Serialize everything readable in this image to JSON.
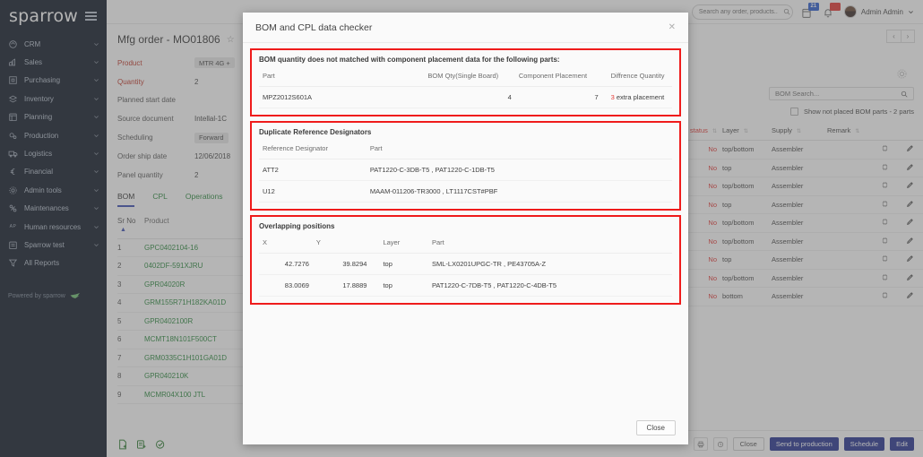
{
  "sidebar": {
    "brand": "sparrow",
    "footer": "Powered by sparrow",
    "items": [
      {
        "label": "CRM",
        "icon": "crm-icon",
        "expandable": true
      },
      {
        "label": "Sales",
        "icon": "sales-icon",
        "expandable": true
      },
      {
        "label": "Purchasing",
        "icon": "purchasing-icon",
        "expandable": true
      },
      {
        "label": "Inventory",
        "icon": "inventory-icon",
        "expandable": true
      },
      {
        "label": "Planning",
        "icon": "planning-icon",
        "expandable": true
      },
      {
        "label": "Production",
        "icon": "production-icon",
        "expandable": true
      },
      {
        "label": "Logistics",
        "icon": "logistics-icon",
        "expandable": true
      },
      {
        "label": "Financial",
        "icon": "financial-icon",
        "expandable": true
      },
      {
        "label": "Admin tools",
        "icon": "admin-tools-icon",
        "expandable": true
      },
      {
        "label": "Maintenances",
        "icon": "maintenances-icon",
        "expandable": true
      },
      {
        "label": "Human resources",
        "icon": "human-resources-icon",
        "expandable": true
      },
      {
        "label": "Sparrow test",
        "icon": "sparrow-test-icon",
        "expandable": true
      },
      {
        "label": "All Reports",
        "icon": "all-reports-icon",
        "expandable": false
      }
    ]
  },
  "topbar": {
    "search_placeholder": "Search any order, products..",
    "calendar_badge": "21",
    "notification_badge": "55",
    "user_name": "Admin Admin"
  },
  "order": {
    "title": "Mfg order - MO01806",
    "fields": [
      {
        "label": "Product",
        "value": "MTR 4G +",
        "required": true,
        "pill": true
      },
      {
        "label": "Quantity",
        "value": "2",
        "required": true,
        "pill": false
      },
      {
        "label": "Planned start date",
        "value": "",
        "required": false,
        "pill": false
      },
      {
        "label": "Source document",
        "value": "Intellal-1C",
        "required": false,
        "pill": false
      },
      {
        "label": "Scheduling",
        "value": "Forward",
        "required": false,
        "pill": true
      },
      {
        "label": "Order ship date",
        "value": "12/06/2018",
        "required": false,
        "pill": false
      },
      {
        "label": "Panel quantity",
        "value": "2",
        "required": false,
        "pill": false
      }
    ],
    "tabs": [
      {
        "label": "BOM",
        "active": true
      },
      {
        "label": "CPL",
        "active": false
      },
      {
        "label": "Operations",
        "active": false
      }
    ]
  },
  "bom_table": {
    "columns": {
      "sr_no": "Sr No",
      "product": "Product"
    },
    "rows": [
      {
        "sr": "1",
        "product": "GPC0402104-16"
      },
      {
        "sr": "2",
        "product": "0402DF-591XJRU"
      },
      {
        "sr": "3",
        "product": "GPR04020R"
      },
      {
        "sr": "4",
        "product": "GRM155R71H182KA01D"
      },
      {
        "sr": "5",
        "product": "GPR0402100R"
      },
      {
        "sr": "6",
        "product": "MCMT18N101F500CT"
      },
      {
        "sr": "7",
        "product": "GRM0335C1H101GA01D"
      },
      {
        "sr": "8",
        "product": "GPR040210K"
      },
      {
        "sr": "9",
        "product": "MCMR04X100 JTL"
      }
    ]
  },
  "right_panel": {
    "bom_search_placeholder": "BOM Search...",
    "not_placed_label": "Show not placed BOM parts - 2 parts",
    "columns": {
      "stock_status": "k status",
      "layer": "Layer",
      "supply": "Supply",
      "remark": "Remark"
    },
    "rows": [
      {
        "status": "No",
        "layer": "top/bottom",
        "supply": "Assembler",
        "remark": ""
      },
      {
        "status": "No",
        "layer": "top",
        "supply": "Assembler",
        "remark": ""
      },
      {
        "status": "No",
        "layer": "top/bottom",
        "supply": "Assembler",
        "remark": ""
      },
      {
        "status": "No",
        "layer": "top",
        "supply": "Assembler",
        "remark": ""
      },
      {
        "status": "No",
        "layer": "top/bottom",
        "supply": "Assembler",
        "remark": ""
      },
      {
        "status": "No",
        "layer": "top/bottom",
        "supply": "Assembler",
        "remark": ""
      },
      {
        "status": "No",
        "layer": "top",
        "supply": "Assembler",
        "remark": ""
      },
      {
        "status": "No",
        "layer": "top/bottom",
        "supply": "Assembler",
        "remark": ""
      },
      {
        "status": "No",
        "layer": "bottom",
        "supply": "Assembler",
        "remark": ""
      }
    ],
    "footer_buttons": {
      "close": "Close",
      "send_to_production": "Send to production",
      "schedule": "Schedule",
      "edit": "Edit"
    }
  },
  "modal": {
    "title": "BOM and CPL data checker",
    "close_label": "Close",
    "section_bom": {
      "heading": "BOM quantity does not matched with component placement data for the following parts:",
      "columns": [
        "Part",
        "BOM Qty(Single Board)",
        "Component Placement",
        "Diffrence Quantity"
      ],
      "rows": [
        {
          "part": "MPZ2012S601A",
          "bom_qty": "4",
          "component_placement": "7",
          "difference_number": "3",
          "difference_text": "extra placement"
        }
      ]
    },
    "section_duplicate": {
      "heading": "Duplicate Reference Designators",
      "columns": [
        "Reference Designator",
        "Part"
      ],
      "rows": [
        {
          "designator": "ATT2",
          "part": "PAT1220-C-3DB-T5 , PAT1220-C-1DB-T5"
        },
        {
          "designator": "U12",
          "part": "MAAM-011206-TR3000 , LT1117CST#PBF"
        }
      ]
    },
    "section_overlap": {
      "heading": "Overlapping positions",
      "columns": [
        "X",
        "Y",
        "Layer",
        "Part"
      ],
      "rows": [
        {
          "x": "42.7276",
          "y": "39.8294",
          "layer": "top",
          "part": "SML-LX0201UPGC-TR , PE43705A-Z"
        },
        {
          "x": "83.0069",
          "y": "17.8889",
          "layer": "top",
          "part": "PAT1220-C-7DB-T5 , PAT1220-C-4DB-T5"
        }
      ]
    }
  },
  "colors": {
    "sidebar_bg": "#131c2b",
    "highlight_red": "#ef1b1b",
    "primary_blue": "#283593",
    "link_green": "#2e8b40",
    "danger_red": "#e53935"
  }
}
